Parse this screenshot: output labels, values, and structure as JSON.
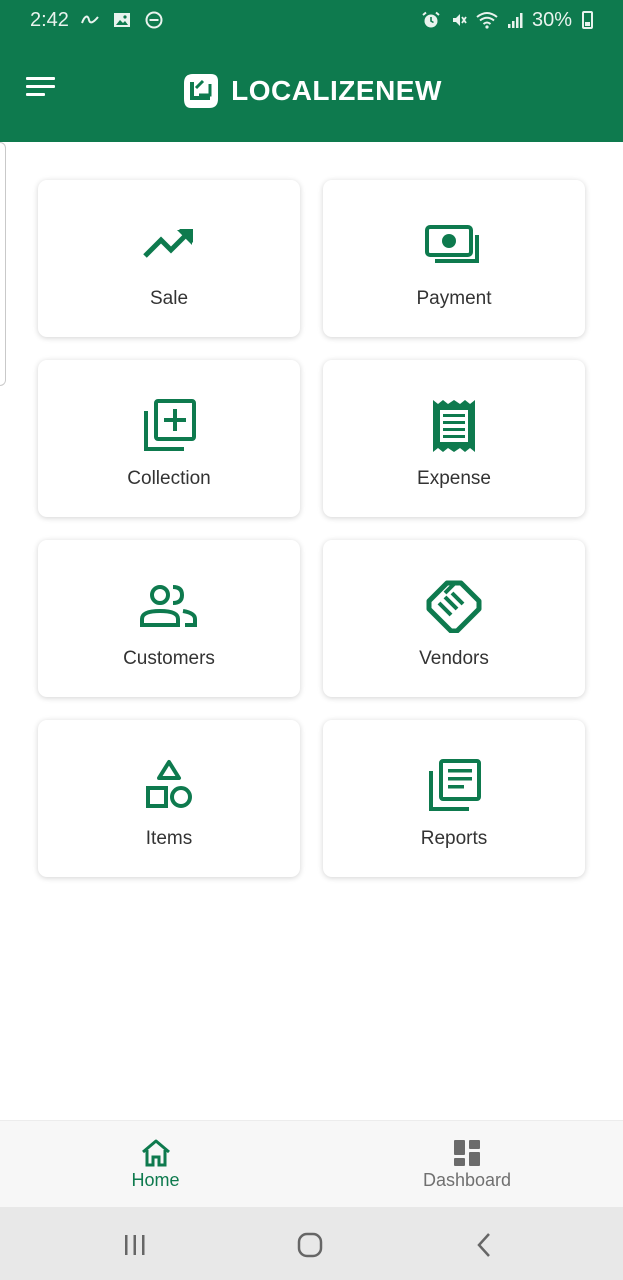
{
  "status_bar": {
    "time": "2:42",
    "battery_percent": "30%"
  },
  "app_bar": {
    "title": "LOCALIZENEW"
  },
  "tiles": [
    {
      "label": "Sale",
      "icon": "trending-up-icon"
    },
    {
      "label": "Payment",
      "icon": "cash-icon"
    },
    {
      "label": "Collection",
      "icon": "library-add-icon"
    },
    {
      "label": "Expense",
      "icon": "receipt-icon"
    },
    {
      "label": "Customers",
      "icon": "people-icon"
    },
    {
      "label": "Vendors",
      "icon": "handshake-icon"
    },
    {
      "label": "Items",
      "icon": "shapes-icon"
    },
    {
      "label": "Reports",
      "icon": "newspaper-icon"
    }
  ],
  "bottom_nav": [
    {
      "label": "Home",
      "icon": "home-icon",
      "active": true
    },
    {
      "label": "Dashboard",
      "icon": "dashboard-icon",
      "active": false
    }
  ],
  "colors": {
    "primary": "#0e7a4e",
    "inactive": "#707070",
    "background": "#ffffff"
  }
}
